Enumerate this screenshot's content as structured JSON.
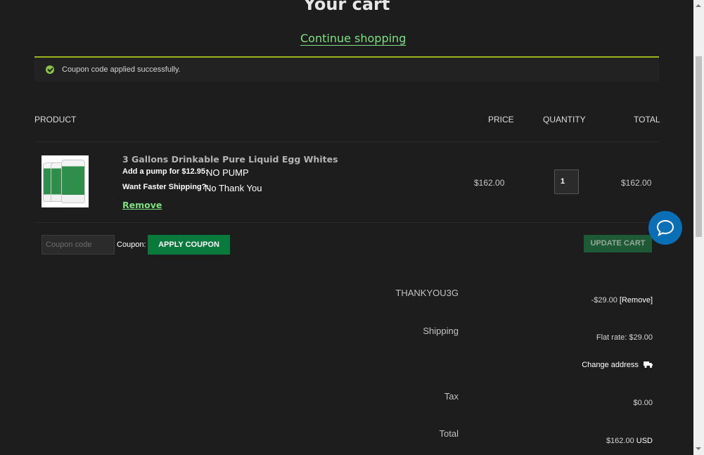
{
  "page": {
    "title": "Your cart",
    "continue_label": "Continue shopping"
  },
  "notice": {
    "message": "Coupon code applied successfully."
  },
  "table": {
    "headers": {
      "product": "PRODUCT",
      "price": "PRICE",
      "quantity": "QUANTITY",
      "total": "TOTAL"
    }
  },
  "item": {
    "name": "3 Gallons Drinkable Pure Liquid Egg Whites",
    "option1_label": "Add a pump for $12.95:",
    "option1_value": "NO PUMP",
    "option2_label": "Want Faster Shipping?:",
    "option2_value": "No Thank You",
    "remove_label": "Remove",
    "price": "$162.00",
    "quantity": "1",
    "total": "$162.00"
  },
  "coupon": {
    "placeholder": "Coupon code",
    "label": "Coupon:",
    "apply_label": "APPLY COUPON",
    "update_label": "UPDATE CART"
  },
  "summary": {
    "coupon_label": "THANKYOU3G",
    "coupon_value": "-$29.00",
    "coupon_remove": "[Remove]",
    "shipping_label": "Shipping",
    "shipping_value": "Flat rate: $29.00",
    "change_address": "Change address",
    "tax_label": "Tax",
    "tax_value": "$0.00",
    "total_label": "Total",
    "total_value": "$162.00",
    "total_currency": "USD"
  },
  "colors": {
    "accent_green": "#7ee081",
    "button_green": "#0a7a3c",
    "notice_border": "#9ab41d",
    "chat_blue": "#0b6fb5"
  },
  "icons": {
    "notice": "check-circle-icon",
    "chat": "chat-bubble-icon",
    "change_address": "truck-icon"
  }
}
